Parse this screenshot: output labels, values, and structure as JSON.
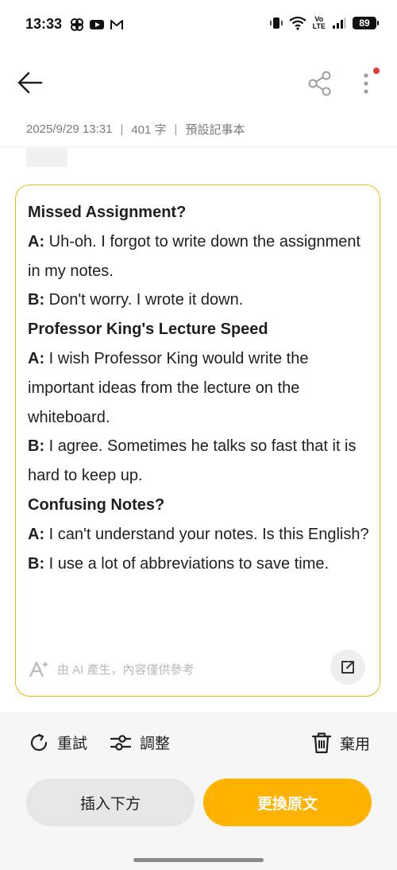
{
  "status_bar": {
    "time": "13:33",
    "battery": "89",
    "app_icons": [
      "pinwheel-icon",
      "youtube-icon",
      "gmail-icon"
    ],
    "right_icons": [
      "vibrate-icon",
      "wifi-icon",
      "volte-icon",
      "signal-icon",
      "battery-icon"
    ],
    "volte_top": "Vo",
    "volte_bottom": "LTE"
  },
  "toolbar": {
    "back_icon": "arrow-left-icon",
    "share_icon": "share-icon",
    "more_icon": "more-vertical-icon",
    "notification_color": "#e53935"
  },
  "note_meta": {
    "datetime": "2025/9/29 13:31",
    "separator": "|",
    "char_count": "401 字",
    "notebook": "預設記事本"
  },
  "ai_card": {
    "border_color": "#f2b70c",
    "paragraphs": [
      {
        "type": "heading",
        "text": "Missed Assignment?"
      },
      {
        "type": "line",
        "speaker": "A:",
        "text": " Uh-oh. I forgot to write down the assignment in my notes."
      },
      {
        "type": "line",
        "speaker": "B:",
        "text": " Don't worry. I wrote it down."
      },
      {
        "type": "heading",
        "text": "Professor King's Lecture Speed"
      },
      {
        "type": "line",
        "speaker": "A:",
        "text": " I wish Professor King would write the important ideas from the lecture on the whiteboard."
      },
      {
        "type": "line",
        "speaker": "B:",
        "text": " I agree. Sometimes he talks so fast that it is hard to keep up."
      },
      {
        "type": "heading",
        "text": "Confusing Notes?"
      },
      {
        "type": "line",
        "speaker": "A:",
        "text": " I can't understand your notes. Is this English?"
      },
      {
        "type": "line",
        "speaker": "B:",
        "text": " I use a lot of abbreviations to save time."
      }
    ],
    "disclaimer": "由 AI 產生，內容僅供參考",
    "disclaimer_icon": "ai-sparkle-icon",
    "open_icon": "open-external-icon"
  },
  "actions": {
    "retry_label": "重試",
    "adjust_label": "調整",
    "discard_label": "棄用",
    "insert_label": "插入下方",
    "replace_label": "更換原文",
    "accent_color": "#ffb300"
  }
}
